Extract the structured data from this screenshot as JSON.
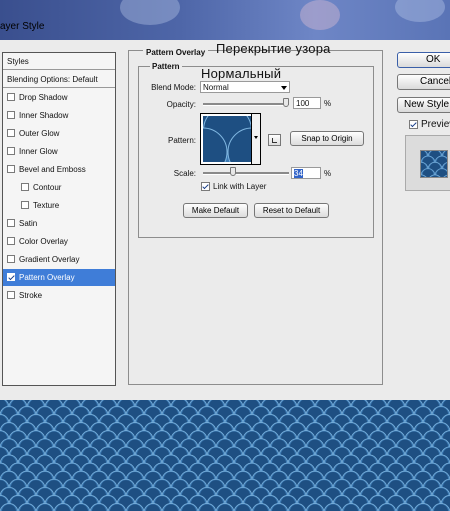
{
  "window": {
    "title": "ayer Style"
  },
  "styles_list": {
    "header": "Styles",
    "blending": "Blending Options: Default",
    "items": [
      {
        "label": "Drop Shadow",
        "checked": false,
        "selected": false,
        "indent": false
      },
      {
        "label": "Inner Shadow",
        "checked": false,
        "selected": false,
        "indent": false
      },
      {
        "label": "Outer Glow",
        "checked": false,
        "selected": false,
        "indent": false
      },
      {
        "label": "Inner Glow",
        "checked": false,
        "selected": false,
        "indent": false
      },
      {
        "label": "Bevel and Emboss",
        "checked": false,
        "selected": false,
        "indent": false
      },
      {
        "label": "Contour",
        "checked": false,
        "selected": false,
        "indent": true
      },
      {
        "label": "Texture",
        "checked": false,
        "selected": false,
        "indent": true
      },
      {
        "label": "Satin",
        "checked": false,
        "selected": false,
        "indent": false
      },
      {
        "label": "Color Overlay",
        "checked": false,
        "selected": false,
        "indent": false
      },
      {
        "label": "Gradient Overlay",
        "checked": false,
        "selected": false,
        "indent": false
      },
      {
        "label": "Pattern Overlay",
        "checked": true,
        "selected": true,
        "indent": false
      },
      {
        "label": "Stroke",
        "checked": false,
        "selected": false,
        "indent": false
      }
    ]
  },
  "panel": {
    "group_title": "Pattern Overlay",
    "subgroup_title": "Pattern",
    "russian_title": "Перекрытие узора",
    "russian_blend": "Нормальный",
    "blend_mode_label": "Blend Mode:",
    "blend_mode_value": "Normal",
    "opacity_label": "Opacity:",
    "opacity_value": "100",
    "opacity_level": 1.0,
    "pattern_label": "Pattern:",
    "snap_button": "Snap to Origin",
    "scale_label": "Scale:",
    "scale_value": "34",
    "scale_level": 0.34,
    "unit_percent": "%",
    "link_label": "Link with Layer",
    "link_checked": true,
    "make_default": "Make Default",
    "reset_default": "Reset to Default"
  },
  "right": {
    "ok": "OK",
    "cancel": "Cancel",
    "new_style": "New Style",
    "preview": "Preview",
    "preview_checked": true
  },
  "colors": {
    "pattern_dark": "#1e4f82",
    "pattern_light": "#3d7ab3",
    "pattern_edge": "#7fb6e0",
    "selection": "#3f7dd8"
  }
}
